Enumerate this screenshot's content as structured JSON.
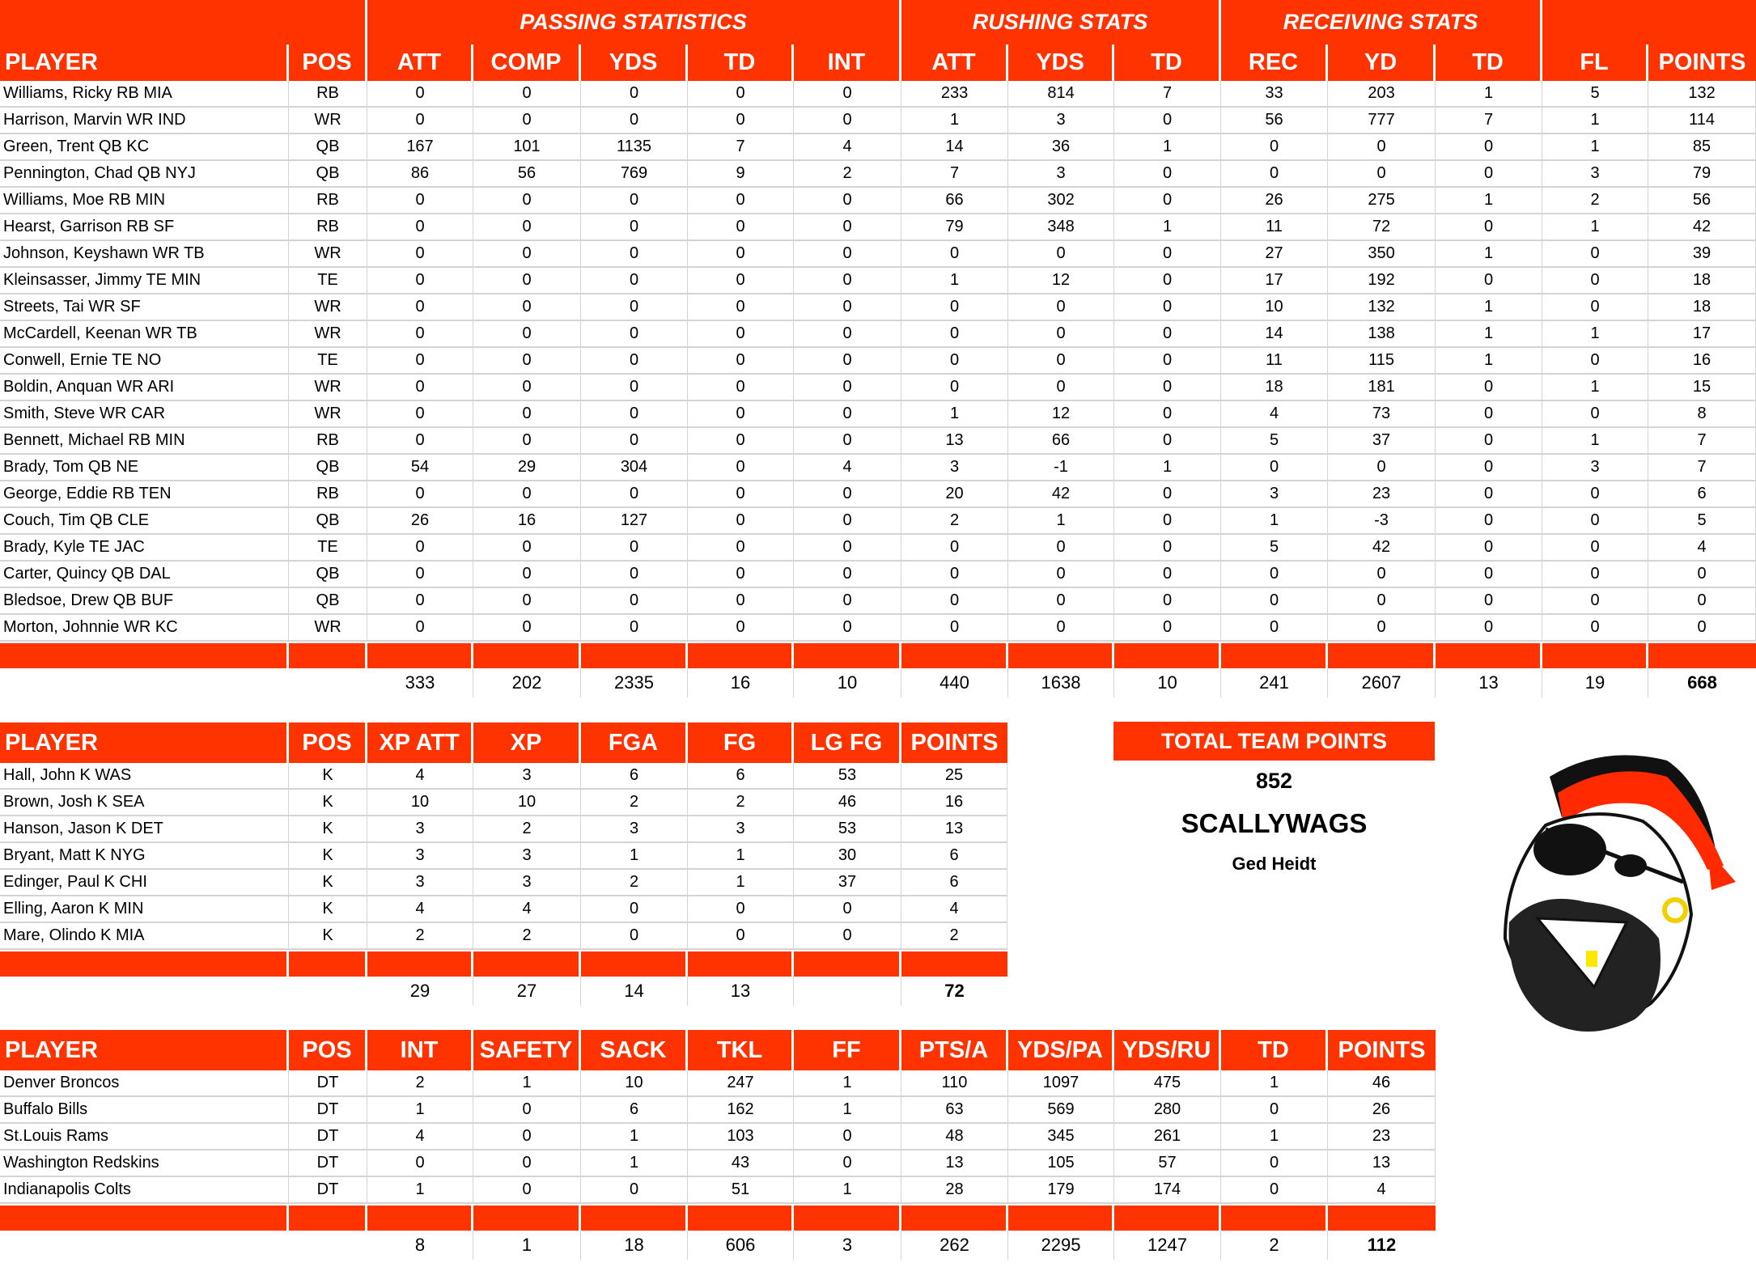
{
  "main_table": {
    "group_headers": {
      "passing": "PASSING STATISTICS",
      "rushing": "RUSHING STATS",
      "receiving": "RECEIVING STATS"
    },
    "columns": [
      "PLAYER",
      "POS",
      "ATT",
      "COMP",
      "YDS",
      "TD",
      "INT",
      "ATT",
      "YDS",
      "TD",
      "REC",
      "YD",
      "TD",
      "FL",
      "POINTS"
    ],
    "rows": [
      [
        "Williams, Ricky RB MIA",
        "RB",
        "0",
        "0",
        "0",
        "0",
        "0",
        "233",
        "814",
        "7",
        "33",
        "203",
        "1",
        "5",
        "132"
      ],
      [
        "Harrison, Marvin WR IND",
        "WR",
        "0",
        "0",
        "0",
        "0",
        "0",
        "1",
        "3",
        "0",
        "56",
        "777",
        "7",
        "1",
        "114"
      ],
      [
        "Green, Trent QB KC",
        "QB",
        "167",
        "101",
        "1135",
        "7",
        "4",
        "14",
        "36",
        "1",
        "0",
        "0",
        "0",
        "1",
        "85"
      ],
      [
        "Pennington, Chad QB NYJ",
        "QB",
        "86",
        "56",
        "769",
        "9",
        "2",
        "7",
        "3",
        "0",
        "0",
        "0",
        "0",
        "3",
        "79"
      ],
      [
        "Williams, Moe RB MIN",
        "RB",
        "0",
        "0",
        "0",
        "0",
        "0",
        "66",
        "302",
        "0",
        "26",
        "275",
        "1",
        "2",
        "56"
      ],
      [
        "Hearst, Garrison RB SF",
        "RB",
        "0",
        "0",
        "0",
        "0",
        "0",
        "79",
        "348",
        "1",
        "11",
        "72",
        "0",
        "1",
        "42"
      ],
      [
        "Johnson, Keyshawn WR TB",
        "WR",
        "0",
        "0",
        "0",
        "0",
        "0",
        "0",
        "0",
        "0",
        "27",
        "350",
        "1",
        "0",
        "39"
      ],
      [
        "Kleinsasser, Jimmy TE MIN",
        "TE",
        "0",
        "0",
        "0",
        "0",
        "0",
        "1",
        "12",
        "0",
        "17",
        "192",
        "0",
        "0",
        "18"
      ],
      [
        "Streets, Tai WR SF",
        "WR",
        "0",
        "0",
        "0",
        "0",
        "0",
        "0",
        "0",
        "0",
        "10",
        "132",
        "1",
        "0",
        "18"
      ],
      [
        "McCardell, Keenan WR TB",
        "WR",
        "0",
        "0",
        "0",
        "0",
        "0",
        "0",
        "0",
        "0",
        "14",
        "138",
        "1",
        "1",
        "17"
      ],
      [
        "Conwell, Ernie TE NO",
        "TE",
        "0",
        "0",
        "0",
        "0",
        "0",
        "0",
        "0",
        "0",
        "11",
        "115",
        "1",
        "0",
        "16"
      ],
      [
        "Boldin, Anquan WR ARI",
        "WR",
        "0",
        "0",
        "0",
        "0",
        "0",
        "0",
        "0",
        "0",
        "18",
        "181",
        "0",
        "1",
        "15"
      ],
      [
        "Smith, Steve WR CAR",
        "WR",
        "0",
        "0",
        "0",
        "0",
        "0",
        "1",
        "12",
        "0",
        "4",
        "73",
        "0",
        "0",
        "8"
      ],
      [
        "Bennett, Michael RB MIN",
        "RB",
        "0",
        "0",
        "0",
        "0",
        "0",
        "13",
        "66",
        "0",
        "5",
        "37",
        "0",
        "1",
        "7"
      ],
      [
        "Brady, Tom QB NE",
        "QB",
        "54",
        "29",
        "304",
        "0",
        "4",
        "3",
        "-1",
        "1",
        "0",
        "0",
        "0",
        "3",
        "7"
      ],
      [
        "George, Eddie RB TEN",
        "RB",
        "0",
        "0",
        "0",
        "0",
        "0",
        "20",
        "42",
        "0",
        "3",
        "23",
        "0",
        "0",
        "6"
      ],
      [
        "Couch, Tim QB CLE",
        "QB",
        "26",
        "16",
        "127",
        "0",
        "0",
        "2",
        "1",
        "0",
        "1",
        "-3",
        "0",
        "0",
        "5"
      ],
      [
        "Brady, Kyle TE JAC",
        "TE",
        "0",
        "0",
        "0",
        "0",
        "0",
        "0",
        "0",
        "0",
        "5",
        "42",
        "0",
        "0",
        "4"
      ],
      [
        "Carter, Quincy QB DAL",
        "QB",
        "0",
        "0",
        "0",
        "0",
        "0",
        "0",
        "0",
        "0",
        "0",
        "0",
        "0",
        "0",
        "0"
      ],
      [
        "Bledsoe, Drew QB BUF",
        "QB",
        "0",
        "0",
        "0",
        "0",
        "0",
        "0",
        "0",
        "0",
        "0",
        "0",
        "0",
        "0",
        "0"
      ],
      [
        "Morton, Johnnie WR KC",
        "WR",
        "0",
        "0",
        "0",
        "0",
        "0",
        "0",
        "0",
        "0",
        "0",
        "0",
        "0",
        "0",
        "0"
      ]
    ],
    "totals": [
      "",
      "",
      "333",
      "202",
      "2335",
      "16",
      "10",
      "440",
      "1638",
      "10",
      "241",
      "2607",
      "13",
      "19",
      "668"
    ]
  },
  "kicker_table": {
    "columns": [
      "PLAYER",
      "POS",
      "XP ATT",
      "XP",
      "FGA",
      "FG",
      "LG FG",
      "POINTS"
    ],
    "rows": [
      [
        "Hall, John K WAS",
        "K",
        "4",
        "3",
        "6",
        "6",
        "53",
        "25"
      ],
      [
        "Brown, Josh K SEA",
        "K",
        "10",
        "10",
        "2",
        "2",
        "46",
        "16"
      ],
      [
        "Hanson, Jason K DET",
        "K",
        "3",
        "2",
        "3",
        "3",
        "53",
        "13"
      ],
      [
        "Bryant, Matt K NYG",
        "K",
        "3",
        "3",
        "1",
        "1",
        "30",
        "6"
      ],
      [
        "Edinger, Paul K CHI",
        "K",
        "3",
        "3",
        "2",
        "1",
        "37",
        "6"
      ],
      [
        "Elling, Aaron K MIN",
        "K",
        "4",
        "4",
        "0",
        "0",
        "0",
        "4"
      ],
      [
        "Mare, Olindo K MIA",
        "K",
        "2",
        "2",
        "0",
        "0",
        "0",
        "2"
      ]
    ],
    "totals": [
      "",
      "",
      "29",
      "27",
      "14",
      "13",
      "",
      "72"
    ]
  },
  "defense_table": {
    "columns": [
      "PLAYER",
      "POS",
      "INT",
      "SAFETY",
      "SACK",
      "TKL",
      "FF",
      "PTS/A",
      "YDS/PA",
      "YDS/RU",
      "TD",
      "POINTS"
    ],
    "rows": [
      [
        "Denver Broncos",
        "DT",
        "2",
        "1",
        "10",
        "247",
        "1",
        "110",
        "1097",
        "475",
        "1",
        "46"
      ],
      [
        "Buffalo Bills",
        "DT",
        "1",
        "0",
        "6",
        "162",
        "1",
        "63",
        "569",
        "280",
        "0",
        "26"
      ],
      [
        "St.Louis Rams",
        "DT",
        "4",
        "0",
        "1",
        "103",
        "0",
        "48",
        "345",
        "261",
        "1",
        "23"
      ],
      [
        "Washington Redskins",
        "DT",
        "0",
        "0",
        "1",
        "43",
        "0",
        "13",
        "105",
        "57",
        "0",
        "13"
      ],
      [
        "Indianapolis Colts",
        "DT",
        "1",
        "0",
        "0",
        "51",
        "1",
        "28",
        "179",
        "174",
        "0",
        "4"
      ]
    ],
    "totals": [
      "",
      "",
      "8",
      "1",
      "18",
      "606",
      "3",
      "262",
      "2295",
      "1247",
      "2",
      "112"
    ]
  },
  "team": {
    "total_label": "TOTAL TEAM POINTS",
    "total_points": "852",
    "team_name": "SCALLYWAGS",
    "owner": "Ged Heidt",
    "logo_icon": "pirate-mascot-icon"
  },
  "colors": {
    "header_bg": "#ff3300",
    "header_text": "#ffffff",
    "grid_line": "#d4d4d4"
  }
}
